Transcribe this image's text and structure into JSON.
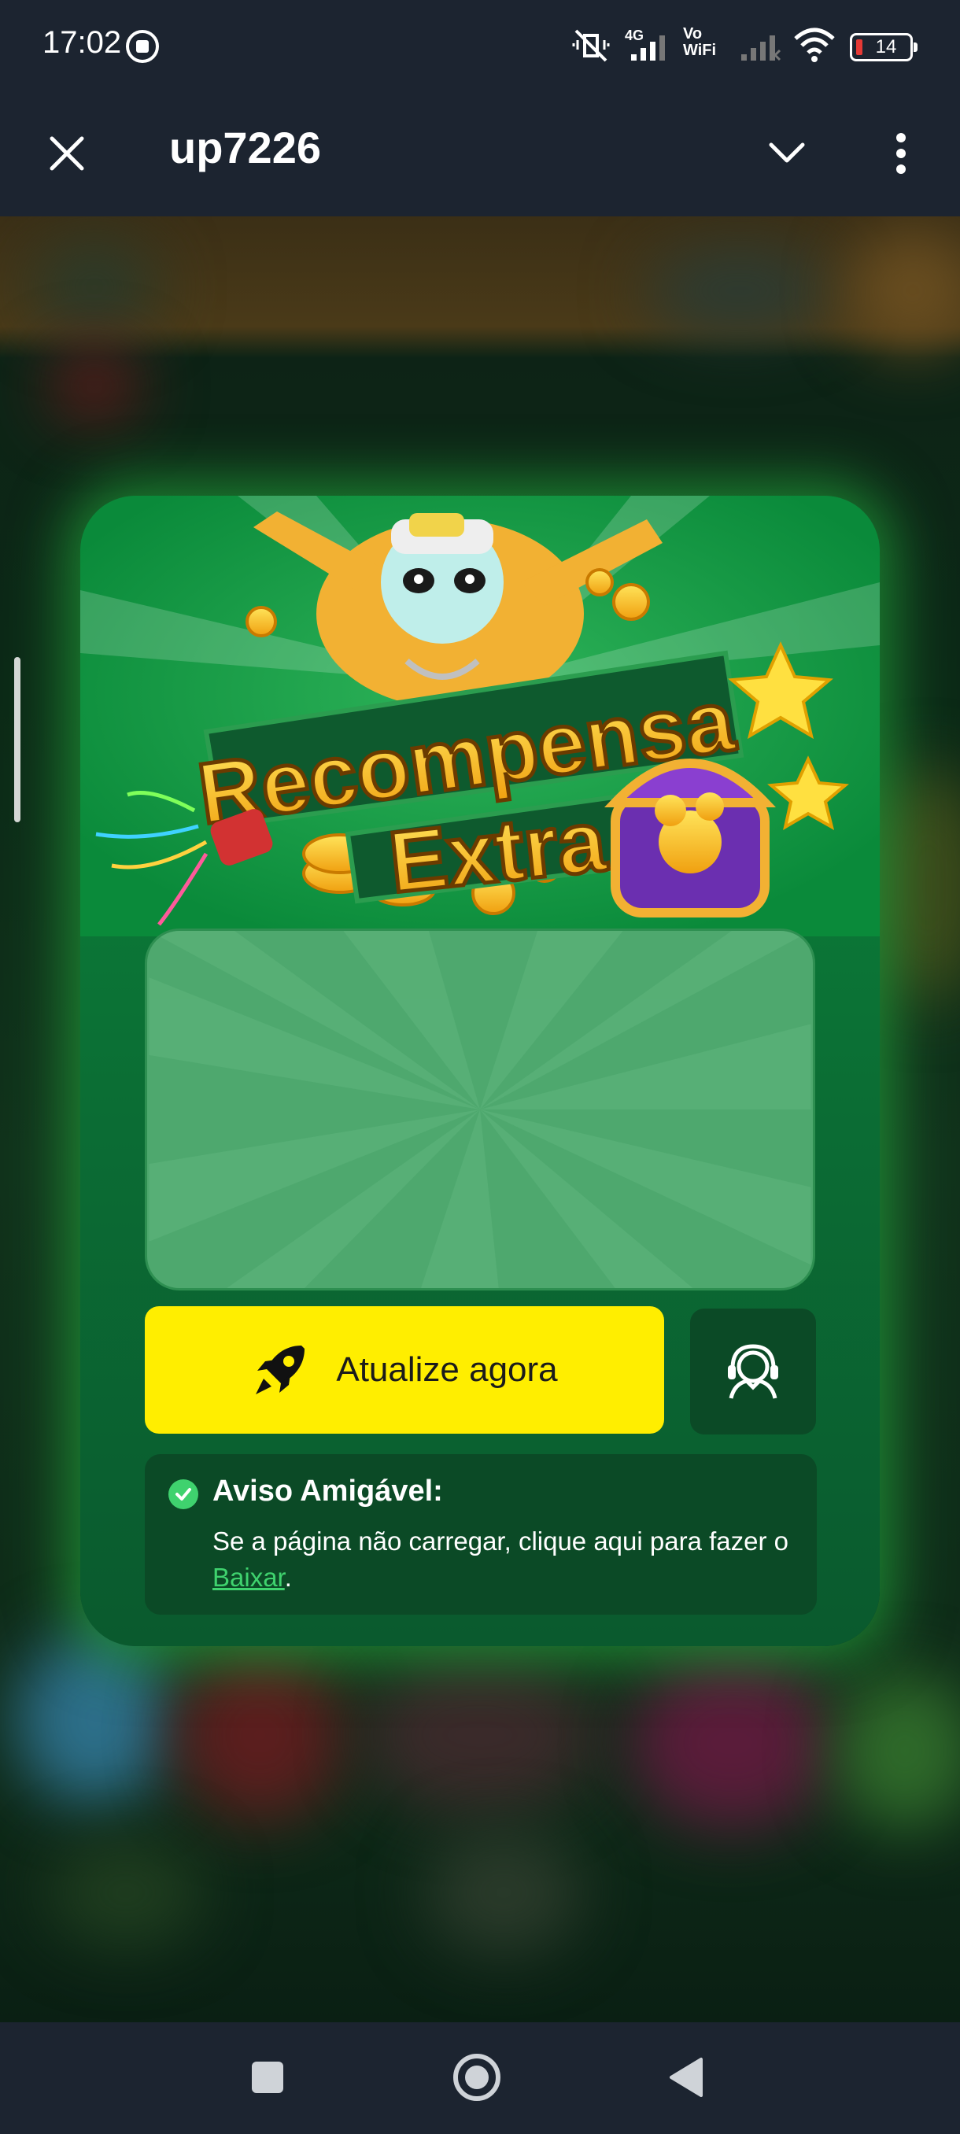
{
  "status_bar": {
    "time": "17:02",
    "network_label": "4G",
    "vowifi_label": "Vo WiFi",
    "battery_level": "14"
  },
  "app_bar": {
    "title": "up7226"
  },
  "modal": {
    "banner_title_line1": "Recompensa",
    "banner_title_line2": "Extra",
    "update_button_label": "Atualize agora",
    "notice": {
      "title": "Aviso Amigável:",
      "text_before_link": "Se a página não carregar, clique aqui para fazer o ",
      "link_label": "Baixar",
      "text_after_link": "."
    }
  },
  "colors": {
    "modal_green": "#0a7a36",
    "button_yellow": "#ffee00",
    "link_green": "#3fd26e",
    "system_bar": "#1c2430"
  }
}
